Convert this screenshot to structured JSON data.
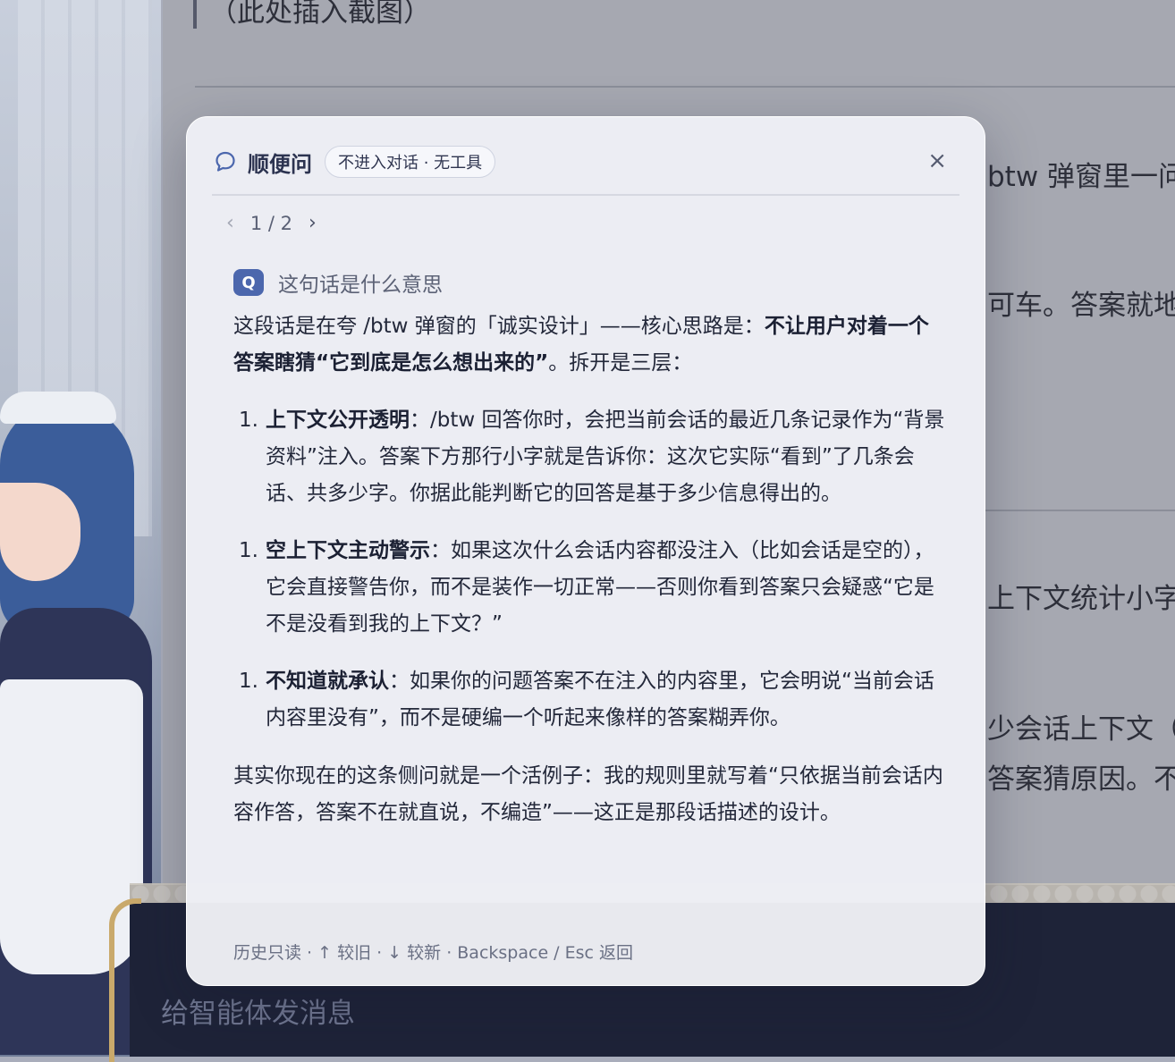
{
  "background": {
    "doc_lines": {
      "top_caption": "（此处插入截图）",
      "line1": "btw 弹窗里一问",
      "line2": "可车。答案就地",
      "line3": "上下文统计小字",
      "line4": "少会话上下文（几",
      "line5": "答案猜原因。不"
    },
    "input_placeholder": "给智能体发消息"
  },
  "popup": {
    "title": "顺便问",
    "tag": "不进入对话 · 无工具",
    "close_label": "×",
    "pager": {
      "prev": "‹",
      "position": "1 / 2",
      "next": "›"
    },
    "question_badge": "Q",
    "question": "这句话是什么意思",
    "answer": {
      "intro_a": "这段话是在夸 /btw 弹窗的「诚实设计」——核心思路是：",
      "intro_bold": "不让用户对着一个答案瞎猜“它到底是怎么想出来的”",
      "intro_b": "。拆开是三层：",
      "items": [
        {
          "num": "1.",
          "heading": "上下文公开透明",
          "body": "：/btw 回答你时，会把当前会话的最近几条记录作为“背景资料”注入。答案下方那行小字就是告诉你：这次它实际“看到”了几条会话、共多少字。你据此能判断它的回答是基于多少信息得出的。"
        },
        {
          "num": "1.",
          "heading": "空上下文主动警示",
          "body": "：如果这次什么会话内容都没注入（比如会话是空的），它会直接警告你，而不是装作一切正常——否则你看到答案只会疑惑“它是不是没看到我的上下文？”"
        },
        {
          "num": "1.",
          "heading": "不知道就承认",
          "body": "：如果你的问题答案不在注入的内容里，它会明说“当前会话内容里没有”，而不是硬编一个听起来像样的答案糊弄你。"
        }
      ],
      "closing": "其实你现在的这条侧问就是一个活例子：我的规则里就写着“只依据当前会话内容作答，答案不在就直说，不编造”——这正是那段话描述的设计。"
    },
    "footer": "历史只读 · ↑ 较旧 · ↓ 较新 · Backspace / Esc 返回"
  },
  "colors": {
    "accent": "#4c67ad",
    "popup_bg": "#eeeff5",
    "text": "#23283a"
  },
  "icons": [
    "chat-bubble-icon",
    "close-icon",
    "chevron-left-icon",
    "chevron-right-icon"
  ]
}
